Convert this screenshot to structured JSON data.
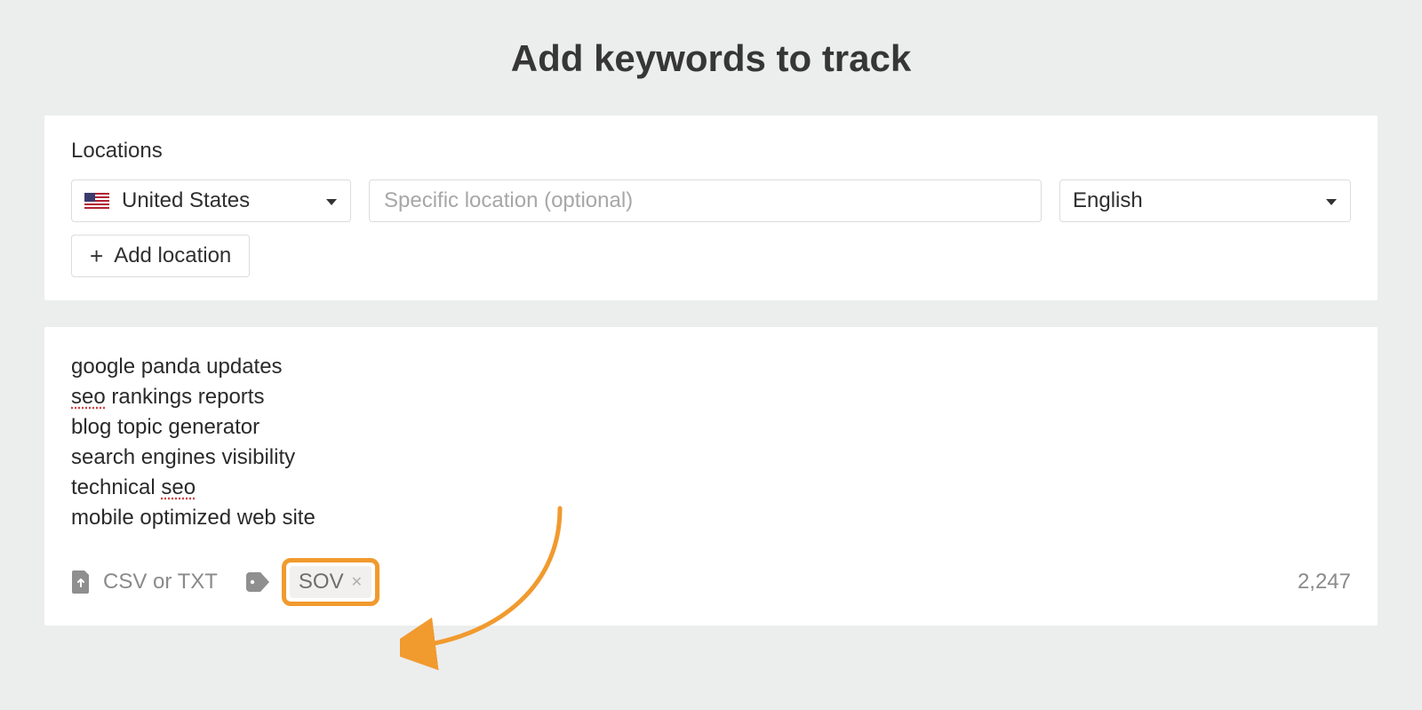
{
  "title": "Add keywords to track",
  "locations": {
    "label": "Locations",
    "country": "United States",
    "specific_placeholder": "Specific location (optional)",
    "language": "English",
    "add_button": "Add location"
  },
  "keywords": {
    "lines": [
      "google panda updates",
      "seo rankings reports",
      "blog topic generator",
      "search engines visibility",
      "technical seo",
      "mobile optimized web site"
    ]
  },
  "footer": {
    "upload_label": "CSV or TXT",
    "tag": "SOV",
    "count": "2,247"
  }
}
